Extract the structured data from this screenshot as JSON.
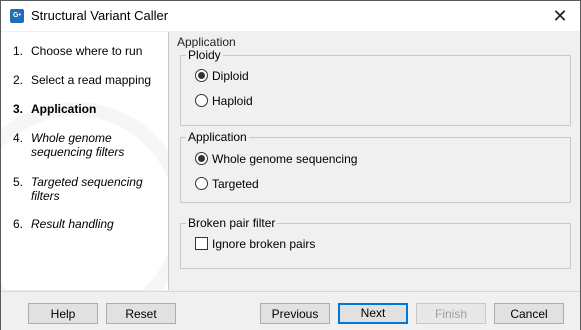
{
  "window": {
    "title": "Structural Variant Caller",
    "app_icon_text": "G•"
  },
  "steps": [
    {
      "num": "1.",
      "label": "Choose where to run"
    },
    {
      "num": "2.",
      "label": "Select a read mapping"
    },
    {
      "num": "3.",
      "label": "Application"
    },
    {
      "num": "4.",
      "label": "Whole genome sequencing filters"
    },
    {
      "num": "5.",
      "label": "Targeted sequencing filters"
    },
    {
      "num": "6.",
      "label": "Result handling"
    }
  ],
  "content": {
    "section_title": "Application",
    "ploidy": {
      "legend": "Ploidy",
      "options": [
        "Diploid",
        "Haploid"
      ],
      "selected": "Diploid"
    },
    "application": {
      "legend": "Application",
      "options": [
        "Whole genome sequencing",
        "Targeted"
      ],
      "selected": "Whole genome sequencing"
    },
    "broken_pair": {
      "legend": "Broken pair filter",
      "checkbox_label": "Ignore broken pairs",
      "checked": false
    }
  },
  "buttons": {
    "help": "Help",
    "reset": "Reset",
    "previous": "Previous",
    "next": "Next",
    "finish": "Finish",
    "cancel": "Cancel"
  },
  "colors": {
    "accent": "#0078d7",
    "icon_bg": "#1f6fb4"
  }
}
